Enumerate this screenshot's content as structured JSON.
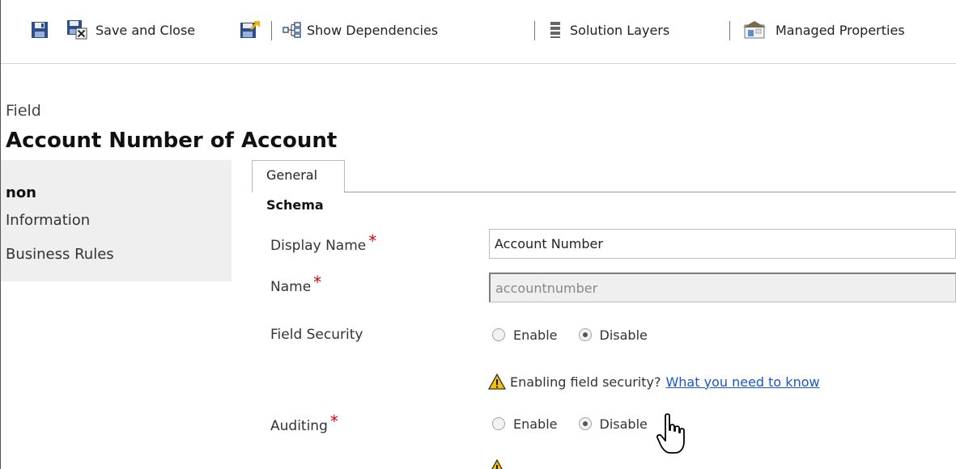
{
  "toolbar": {
    "save_and_close": "Save and Close",
    "show_dependencies": "Show Dependencies",
    "solution_layers": "Solution Layers",
    "managed_properties": "Managed Properties"
  },
  "header": {
    "entity_label": "Field",
    "title": "Account Number of Account"
  },
  "leftnav": {
    "items": [
      "non",
      "Information",
      "Business Rules"
    ]
  },
  "tabs": [
    "General"
  ],
  "section": {
    "title": "Schema"
  },
  "form": {
    "display_name": {
      "label": "Display Name",
      "value": "Account Number"
    },
    "name": {
      "label": "Name",
      "value": "accountnumber"
    },
    "field_security": {
      "label": "Field Security",
      "options": [
        "Enable",
        "Disable"
      ],
      "selected": "Disable",
      "warning_text": "Enabling field security?",
      "warning_link": "What you need to know"
    },
    "auditing": {
      "label": "Auditing",
      "options": [
        "Enable",
        "Disable"
      ],
      "selected": "Disable"
    }
  },
  "colors": {
    "required": "#d0021b",
    "link": "#1a56c9",
    "warning": "#f2c200",
    "nav_background": "#efefef"
  },
  "icons": [
    "save-icon",
    "save-and-close-icon",
    "save-and-publish-icon",
    "dependencies-icon",
    "solution-layers-icon",
    "managed-properties-icon",
    "warning-icon",
    "hand-cursor-icon"
  ]
}
